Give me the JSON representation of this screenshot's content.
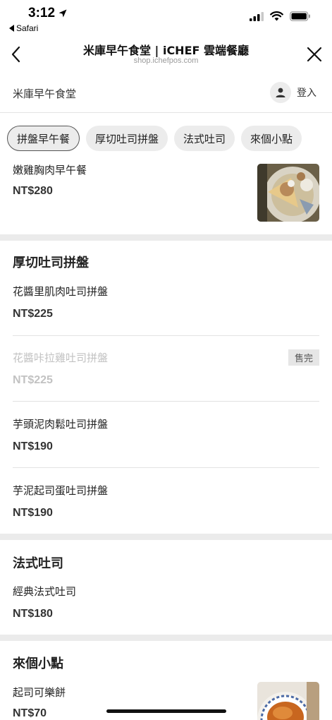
{
  "status": {
    "time": "3:12",
    "back_app": "Safari"
  },
  "nav": {
    "title": "米庫早午食堂 | iCHEF 雲端餐廳",
    "subtitle": "shop.ichefpos.com"
  },
  "store": {
    "name": "米庫早午食堂",
    "login_label": "登入"
  },
  "tabs": [
    "拼盤早午餐",
    "厚切吐司拼盤",
    "法式吐司",
    "來個小點"
  ],
  "items": {
    "first": {
      "name": "嫩雞胸肉早午餐",
      "price": "NT$280"
    },
    "thick_toast": {
      "title": "厚切吐司拼盤",
      "items": [
        {
          "name": "花醬里肌肉吐司拼盤",
          "price": "NT$225"
        },
        {
          "name": "花醬咔拉雞吐司拼盤",
          "price": "NT$225",
          "badge": "售完"
        },
        {
          "name": "芋頭泥肉鬆吐司拼盤",
          "price": "NT$190"
        },
        {
          "name": "芋泥起司蛋吐司拼盤",
          "price": "NT$190"
        }
      ]
    },
    "french_toast": {
      "title": "法式吐司",
      "items": [
        {
          "name": "經典法式吐司",
          "price": "NT$180"
        }
      ]
    },
    "snacks": {
      "title": "來個小點",
      "items": [
        {
          "name": "起司可樂餅",
          "price": "NT$70"
        }
      ]
    }
  }
}
